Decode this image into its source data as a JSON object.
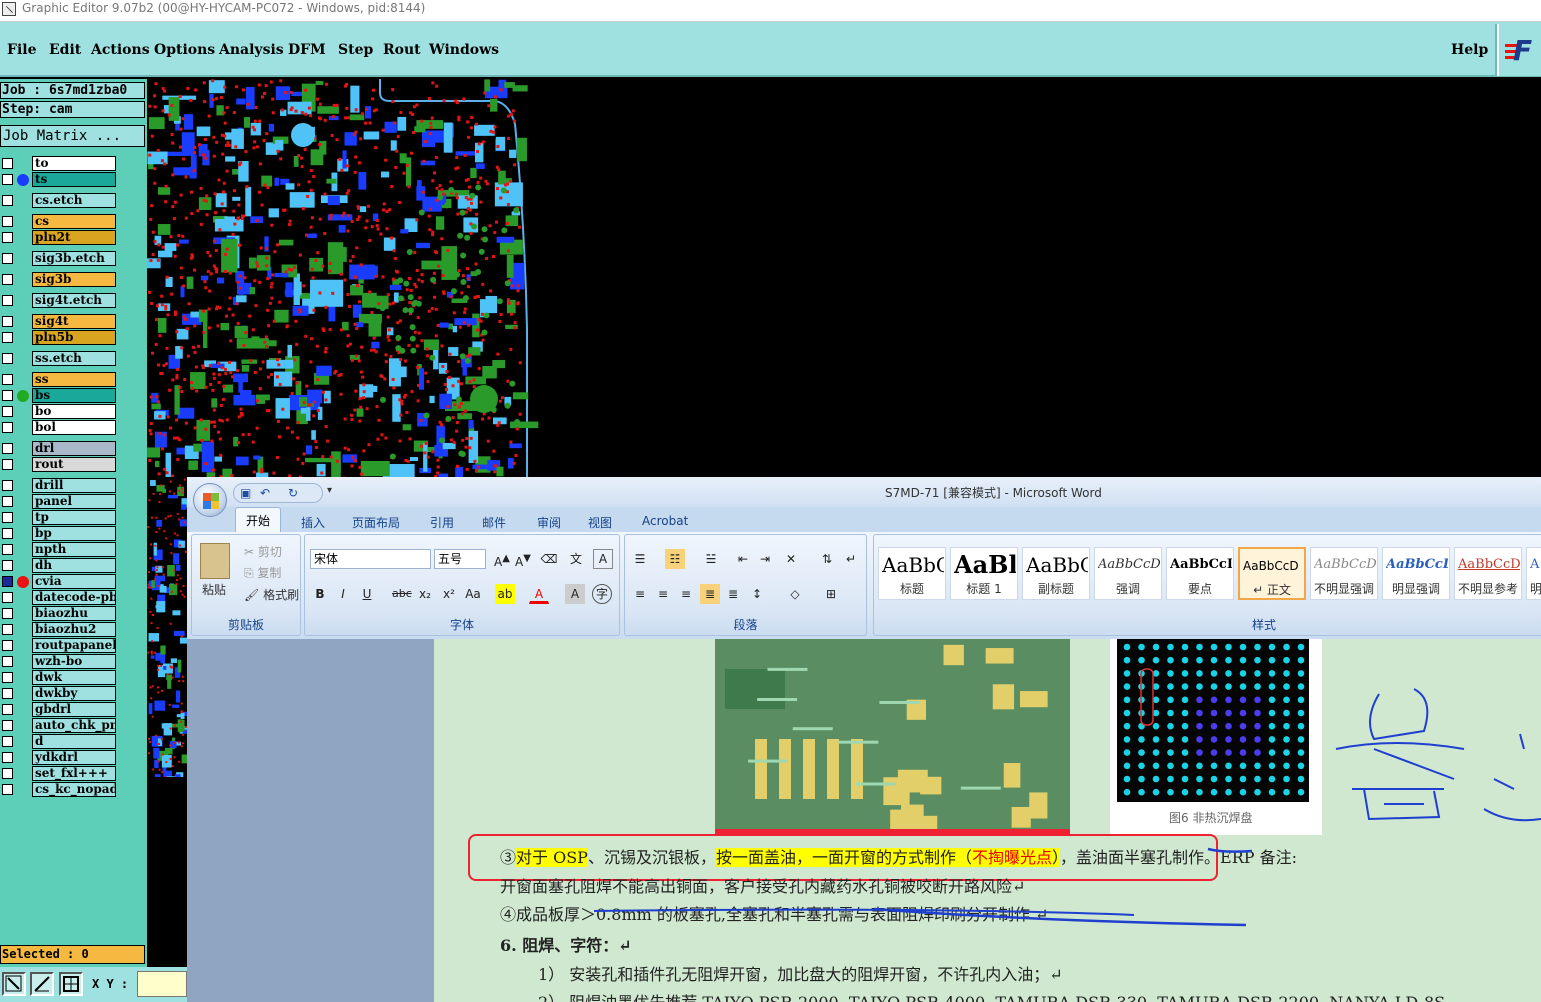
{
  "window": {
    "title": "Graphic Editor 9.07b2 (00@HY-HYCAM-PC072 - Windows, pid:8144)"
  },
  "menu": {
    "items": [
      "File",
      "Edit",
      "Actions",
      "Options",
      "Analysis",
      "DFM",
      "Step",
      "Rout",
      "Windows"
    ],
    "help": "Help",
    "logo": "F"
  },
  "panel": {
    "job": "Job : 6s7md1zba0",
    "step": "Step: cam",
    "job_matrix": "Job Matrix ...",
    "selected": "Selected : 0",
    "xy_label": "X Y :"
  },
  "layers": [
    {
      "name": "to",
      "color": "#ffffff",
      "dot": ""
    },
    {
      "name": "ts",
      "color": "#1aa89a",
      "dot": "#1a3cff"
    },
    {
      "name": "cs.etch",
      "color": "#9fe0e0",
      "dot": ""
    },
    {
      "name": "cs",
      "color": "#f5b942",
      "dot": ""
    },
    {
      "name": "pln2t",
      "color": "#d9a520",
      "dot": ""
    },
    {
      "name": "sig3b.etch",
      "color": "#9fe0e0",
      "dot": ""
    },
    {
      "name": "sig3b",
      "color": "#f5b942",
      "dot": ""
    },
    {
      "name": "sig4t.etch",
      "color": "#9fe0e0",
      "dot": ""
    },
    {
      "name": "sig4t",
      "color": "#f5b942",
      "dot": ""
    },
    {
      "name": "pln5b",
      "color": "#d9a520",
      "dot": ""
    },
    {
      "name": "ss.etch",
      "color": "#9fe0e0",
      "dot": ""
    },
    {
      "name": "ss",
      "color": "#f5b942",
      "dot": ""
    },
    {
      "name": "bs",
      "color": "#1aa89a",
      "dot": "#22aa22"
    },
    {
      "name": "bo",
      "color": "#ffffff",
      "dot": ""
    },
    {
      "name": "bol",
      "color": "#ffffff",
      "dot": ""
    },
    {
      "name": "drl",
      "color": "#a9b9c9",
      "dot": ""
    },
    {
      "name": "rout",
      "color": "#d9d9d9",
      "dot": ""
    },
    {
      "name": "drill",
      "color": "#9fe0e0",
      "dot": ""
    },
    {
      "name": "panel",
      "color": "#9fe0e0",
      "dot": ""
    },
    {
      "name": "tp",
      "color": "#9fe0e0",
      "dot": ""
    },
    {
      "name": "bp",
      "color": "#9fe0e0",
      "dot": ""
    },
    {
      "name": "npth",
      "color": "#9fe0e0",
      "dot": ""
    },
    {
      "name": "dh",
      "color": "#9fe0e0",
      "dot": ""
    },
    {
      "name": "cvia",
      "color": "#9fe0e0",
      "dot": "#ee1111"
    },
    {
      "name": "datecode-pbc",
      "color": "#9fe0e0",
      "dot": ""
    },
    {
      "name": "biaozhu",
      "color": "#9fe0e0",
      "dot": ""
    },
    {
      "name": "biaozhu2",
      "color": "#9fe0e0",
      "dot": ""
    },
    {
      "name": "routpapanelb",
      "color": "#9fe0e0",
      "dot": ""
    },
    {
      "name": "wzh-bo",
      "color": "#9fe0e0",
      "dot": ""
    },
    {
      "name": "dwk",
      "color": "#9fe0e0",
      "dot": ""
    },
    {
      "name": "dwkby",
      "color": "#9fe0e0",
      "dot": ""
    },
    {
      "name": "gbdrl",
      "color": "#9fe0e0",
      "dot": ""
    },
    {
      "name": "auto_chk_pnl",
      "color": "#9fe0e0",
      "dot": ""
    },
    {
      "name": "d",
      "color": "#9fe0e0",
      "dot": ""
    },
    {
      "name": "ydkdrl",
      "color": "#9fe0e0",
      "dot": ""
    },
    {
      "name": "set_fxl+++",
      "color": "#9fe0e0",
      "dot": ""
    },
    {
      "name": "cs_kc_nopad",
      "color": "#9fe0e0",
      "dot": ""
    }
  ],
  "word": {
    "title": "S7MD-71 [兼容模式] - Microsoft Word",
    "tabs": [
      "开始",
      "插入",
      "页面布局",
      "引用",
      "邮件",
      "审阅",
      "视图",
      "Acrobat"
    ],
    "clipboard": {
      "paste": "粘贴",
      "cut": "剪切",
      "copy": "复制",
      "format_painter": "格式刷",
      "label": "剪贴板"
    },
    "font": {
      "name": "宋体",
      "size": "五号",
      "label": "字体"
    },
    "paragraph": {
      "label": "段落"
    },
    "styles": {
      "label": "样式",
      "items": [
        {
          "preview": "AaBbC",
          "name": "标题"
        },
        {
          "preview": "AaBl",
          "name": "标题 1"
        },
        {
          "preview": "AaBbC",
          "name": "副标题"
        },
        {
          "preview": "AaBbCcD",
          "name": "强调"
        },
        {
          "preview": "AaBbCcD",
          "name": "要点"
        },
        {
          "preview": "AaBbCcD",
          "name": "↵ 正文"
        },
        {
          "preview": "AaBbCcD",
          "name": "不明显强调"
        },
        {
          "preview": "AaBbCcD",
          "name": "明显强调"
        },
        {
          "preview": "AaBbCcD",
          "name": "不明显参考"
        },
        {
          "preview": "A",
          "name": "明"
        }
      ]
    },
    "doc": {
      "caption": "图6 非热沉焊盘",
      "line1_a": "③",
      "line1_b": "对于 OSP",
      "line1_c": "、沉锡及沉银板，",
      "line1_d": "按一面盖油，一面开窗的方式制作（",
      "line1_e": "不掏曝光点",
      "line1_f": "）",
      "line1_g": "，盖油面半塞孔制作。ERP 备注:",
      "line2": "开窗面塞孔阻焊不能高出铜面，客户接受孔内藏药水孔铜被咬断开路风险↵",
      "line3": "④成品板厚＞0.8mm 的板塞孔,全塞孔和半塞孔需与表面阻焊印刷分开制作 ↵",
      "line4": "6.   阻焊、字符：↵",
      "line5": "1） 安装孔和插件孔无阻焊开窗，加比盘大的阻焊开窗，不许孔内入油；↵",
      "line6": "2） 阻焊油墨优先推荐 TAIYO PSR-2000, TAIYO PSR-4000, TAMURA  DSR-330, TAMURA DSR-2200, NANYA LD-8S"
    }
  }
}
